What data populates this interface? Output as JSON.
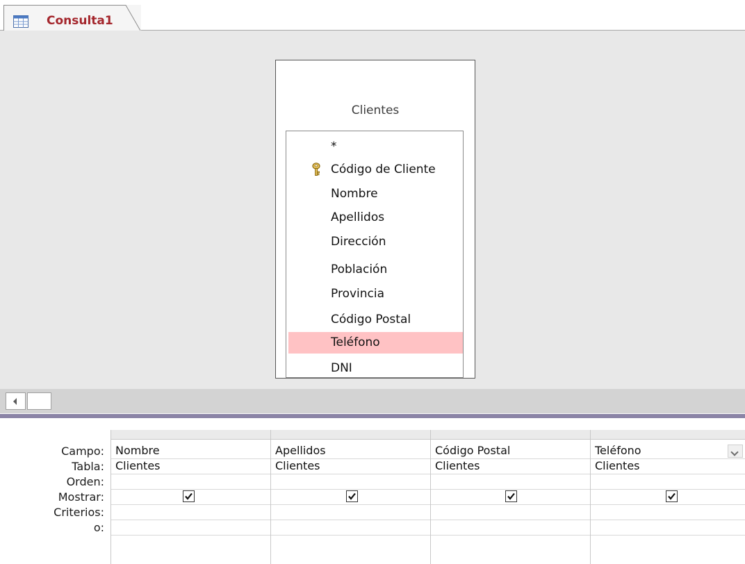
{
  "tab": {
    "title": "Consulta1",
    "icon": "query-datasheet-icon",
    "accent_color": "#a4262c"
  },
  "table": {
    "name": "Clientes",
    "fields": [
      "*",
      "Código de Cliente",
      "Nombre",
      "Apellidos",
      "Dirección",
      "Población",
      "Provincia",
      "Código Postal",
      "Teléfono",
      "DNI"
    ],
    "primary_key_field": "Código de Cliente",
    "selected_field": "Teléfono",
    "selected_color": "#ffc2c4"
  },
  "grid": {
    "row_labels": [
      "Campo:",
      "Tabla:",
      "Orden:",
      "Mostrar:",
      "Criterios:",
      "o:"
    ],
    "columns": [
      {
        "field": "Nombre",
        "table": "Clientes",
        "sort": "",
        "show": true,
        "criteria": "",
        "or": ""
      },
      {
        "field": "Apellidos",
        "table": "Clientes",
        "sort": "",
        "show": true,
        "criteria": "",
        "or": ""
      },
      {
        "field": "Código Postal",
        "table": "Clientes",
        "sort": "",
        "show": true,
        "criteria": "",
        "or": ""
      },
      {
        "field": "Teléfono",
        "table": "Clientes",
        "sort": "",
        "show": true,
        "criteria": "",
        "or": ""
      }
    ]
  }
}
